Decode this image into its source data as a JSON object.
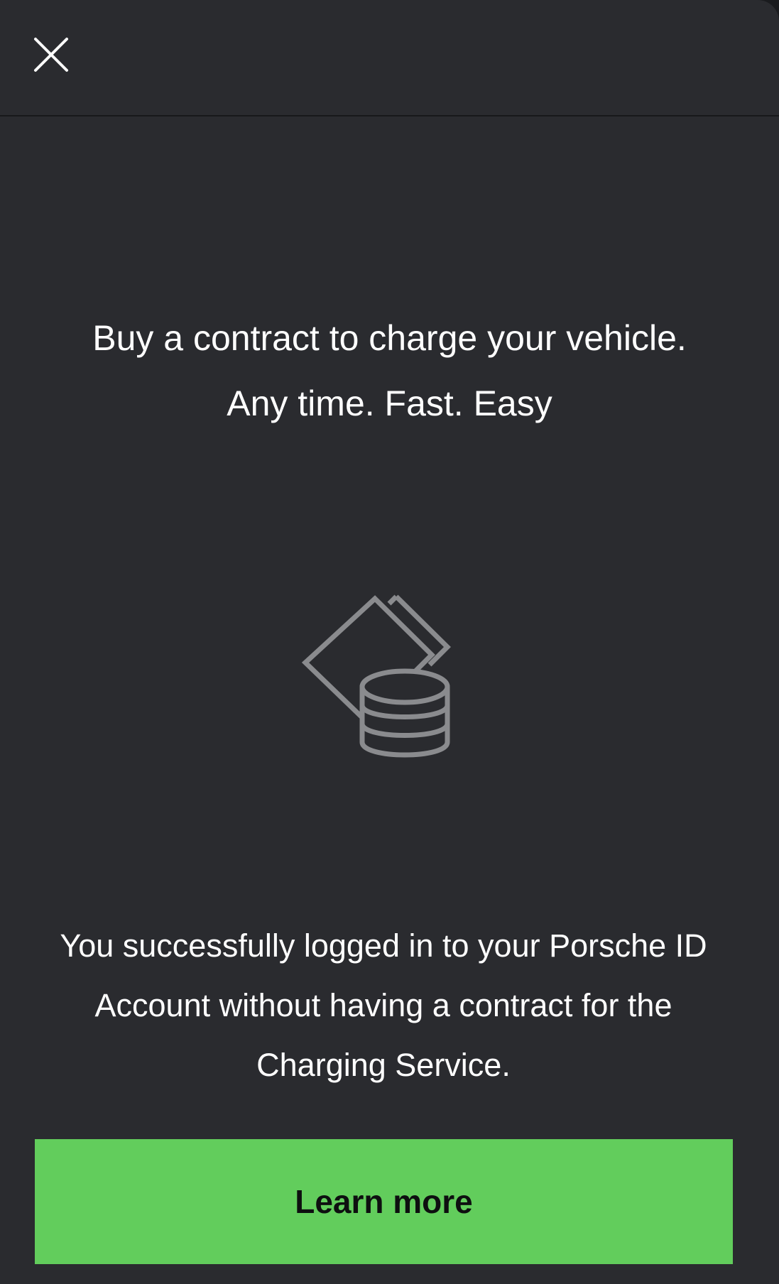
{
  "header": {
    "close_icon": "close-icon"
  },
  "headline": {
    "line1": "Buy a contract to charge your vehicle.",
    "line2": "Any time. Fast. Easy"
  },
  "illustration": {
    "icon": "cards-and-coins-icon",
    "color": "#8a8b8e"
  },
  "message": {
    "line1": "You successfully logged in to your Porsche ID",
    "line2": "Account without having a contract for the",
    "line3": "Charging Service."
  },
  "cta": {
    "label": "Learn more",
    "color": "#62cd5c"
  },
  "colors": {
    "background": "#2a2b2f",
    "text": "#ffffff"
  }
}
